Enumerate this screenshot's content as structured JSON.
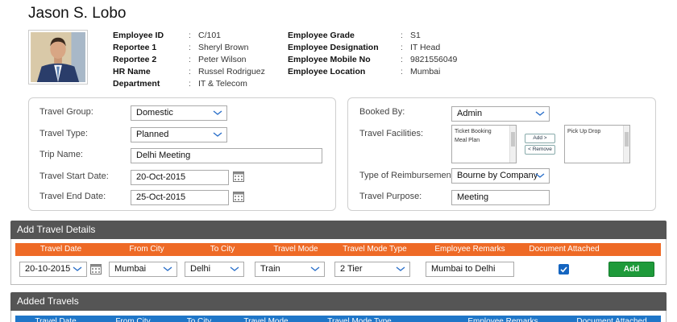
{
  "employee": {
    "name": "Jason S. Lobo",
    "left_fields": [
      {
        "key": "Employee ID",
        "value": "C/101"
      },
      {
        "key": "Reportee 1",
        "value": "Sheryl Brown"
      },
      {
        "key": "Reportee 2",
        "value": "Peter Wilson"
      },
      {
        "key": "HR Name",
        "value": "Russel Rodriguez"
      },
      {
        "key": "Department",
        "value": "IT & Telecom"
      }
    ],
    "right_fields": [
      {
        "key": "Employee Grade",
        "value": "S1"
      },
      {
        "key": "Employee Designation",
        "value": "IT Head"
      },
      {
        "key": "Employee Mobile No",
        "value": "9821556049"
      },
      {
        "key": "Employee Location",
        "value": "Mumbai"
      }
    ],
    "colon": ":"
  },
  "travel_form": {
    "travel_group_label": "Travel Group:",
    "travel_group_value": "Domestic",
    "travel_type_label": "Travel Type:",
    "travel_type_value": "Planned",
    "trip_name_label": "Trip Name:",
    "trip_name_value": "Delhi Meeting",
    "start_date_label": "Travel Start Date:",
    "start_date_value": "20-Oct-2015",
    "end_date_label": "Travel End Date:",
    "end_date_value": "25-Oct-2015"
  },
  "booking_form": {
    "booked_by_label": "Booked By:",
    "booked_by_value": "Admin",
    "facilities_label": "Travel Facilities:",
    "available_facilities": [
      "Ticket Booking",
      "Meal Plan"
    ],
    "selected_facilities": [
      "Pick Up Drop"
    ],
    "add_label": "Add >",
    "remove_label": "< Remove",
    "reimbursement_label": "Type of Reimbursement:",
    "reimbursement_value": "Bourne by Company",
    "purpose_label": "Travel Purpose:",
    "purpose_value": "Meeting"
  },
  "add_travel": {
    "title": "Add Travel Details",
    "columns": [
      "Travel Date",
      "From City",
      "To City",
      "Travel Mode",
      "Travel Mode Type",
      "Employee Remarks",
      "Document Attached"
    ],
    "row": {
      "travel_date": "20-10-2015",
      "from_city": "Mumbai",
      "to_city": "Delhi",
      "travel_mode": "Train",
      "travel_mode_type": "2 Tier",
      "remarks": "Mumbai to Delhi",
      "document_attached": true
    },
    "add_button": "Add",
    "header_color": "#ee6a26",
    "button_color": "#1e9a3a"
  },
  "added_travels": {
    "title": "Added Travels",
    "columns": [
      "Travel Date",
      "From City",
      "To City",
      "Travel Mode",
      "Travel Mode Type",
      "Employee Remarks",
      "Document Attached"
    ],
    "header_color": "#1f76c8"
  }
}
